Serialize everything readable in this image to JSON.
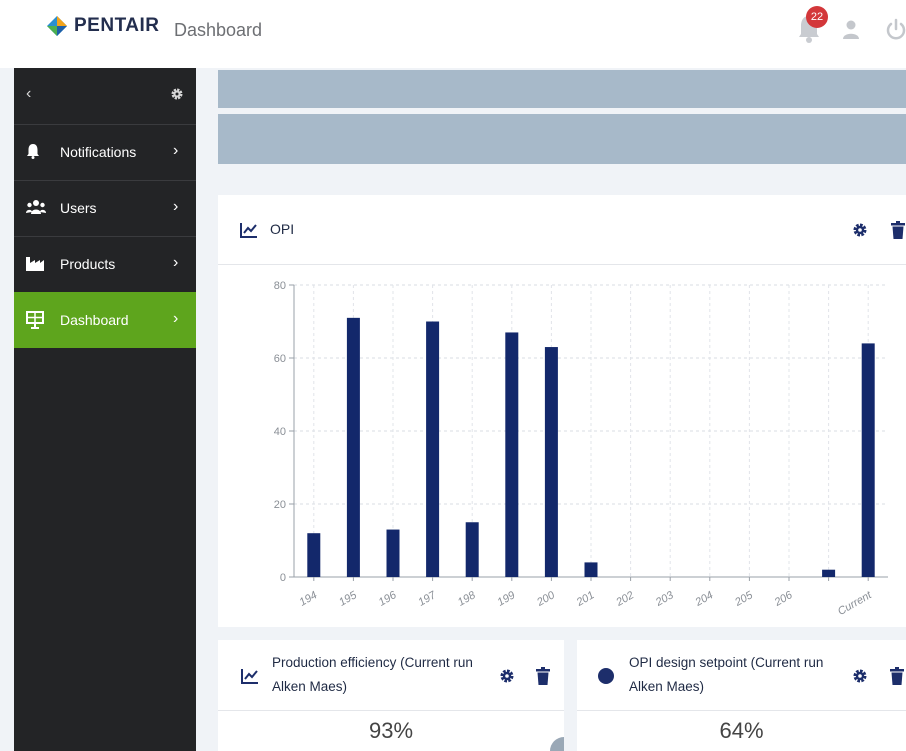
{
  "header": {
    "brand": "PENTAIR",
    "title": "Dashboard",
    "notification_count": "22",
    "icons": [
      "pentair-logo-icon",
      "bell-icon",
      "user-icon",
      "power-icon"
    ]
  },
  "sidebar": {
    "icons": [
      "chevron-left-icon",
      "gear-icon"
    ],
    "items": [
      {
        "label": "Notifications",
        "icon": "bell-icon"
      },
      {
        "label": "Users",
        "icon": "users-icon"
      },
      {
        "label": "Products",
        "icon": "factory-icon"
      },
      {
        "label": "Dashboard",
        "icon": "presentation-board-icon",
        "active": true
      }
    ],
    "active_color": "#5ea51d"
  },
  "opi_card": {
    "title": "OPI",
    "icons": [
      "line-chart-icon",
      "gear-icon",
      "trash-icon"
    ]
  },
  "chart_data": {
    "type": "bar",
    "categories": [
      "194",
      "195",
      "196",
      "197",
      "198",
      "199",
      "200",
      "201",
      "202",
      "203",
      "204",
      "205",
      "206",
      "",
      "Current"
    ],
    "values": [
      12,
      71,
      13,
      70,
      15,
      67,
      63,
      4,
      0,
      0,
      0,
      0,
      0,
      2,
      64
    ],
    "ylim": [
      0,
      80
    ],
    "yticks": [
      0,
      20,
      40,
      60,
      80
    ],
    "grid": true,
    "bar_color": "#13286b"
  },
  "tiles": [
    {
      "title": "Production efficiency (Current run Alken Maes)",
      "value": "93%",
      "icon": "line-chart-icon"
    },
    {
      "title": "OPI design setpoint (Current run Alken Maes)",
      "value": "64%",
      "icon": "dot-icon"
    }
  ],
  "colors": {
    "band": "#a7b9c9",
    "sidebar_bg": "#232426",
    "badge": "#d3373a",
    "navy": "#13286b"
  }
}
